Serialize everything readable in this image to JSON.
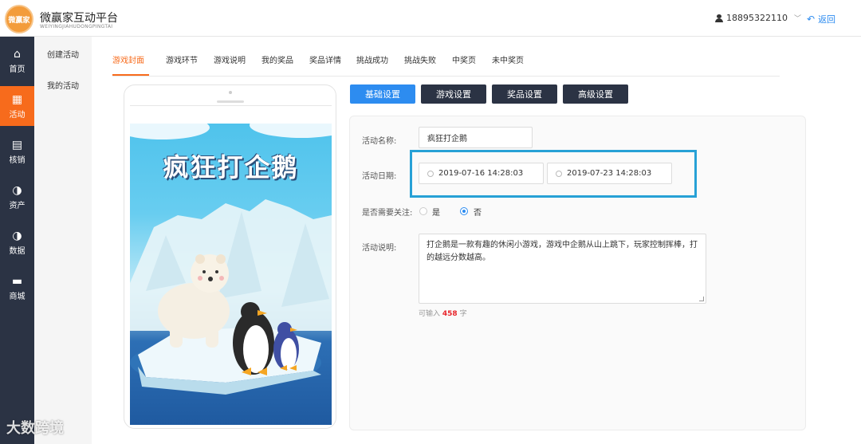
{
  "header": {
    "logo_text": "微赢家",
    "title": "微赢家互动平台",
    "subtitle": "WEIYINGJIAHUDONGPINGTAI",
    "user_phone": "18895322110",
    "back_label": "返回"
  },
  "sidenav": {
    "items": [
      {
        "label": "首页",
        "icon": "home-icon",
        "glyph": "⌂"
      },
      {
        "label": "活动",
        "icon": "gift-icon",
        "glyph": "▦"
      },
      {
        "label": "核销",
        "icon": "verify-icon",
        "glyph": "▤"
      },
      {
        "label": "资产",
        "icon": "asset-pie-icon",
        "glyph": "◑"
      },
      {
        "label": "数据",
        "icon": "data-pie-icon",
        "glyph": "◑"
      },
      {
        "label": "商城",
        "icon": "shop-icon",
        "glyph": "▬"
      }
    ],
    "active_index": 1
  },
  "submenu": {
    "items": [
      "创建活动",
      "我的活动"
    ]
  },
  "tabs": {
    "items": [
      "游戏封面",
      "游戏环节",
      "游戏说明",
      "我的奖品",
      "奖品详情",
      "挑战成功",
      "挑战失败",
      "中奖页",
      "未中奖页"
    ],
    "active_index": 0
  },
  "preview": {
    "game_title": "疯狂打企鹅"
  },
  "settings_tabs": {
    "items": [
      "基础设置",
      "游戏设置",
      "奖品设置",
      "高级设置"
    ],
    "active_index": 0
  },
  "form": {
    "name_label": "活动名称:",
    "name_value": "疯狂打企鹅",
    "date_label": "活动日期:",
    "date_start": "2019-07-16 14:28:03",
    "date_end": "2019-07-23 14:28:03",
    "follow_label": "是否需要关注:",
    "follow_yes": "是",
    "follow_no": "否",
    "follow_selected": "否",
    "desc_label": "活动说明:",
    "desc_value": "打企鹅是一款有趣的休闲小游戏，游戏中企鹅从山上跳下，玩家控制挥棒，打的越远分数越高。",
    "hint_prefix": "可输入",
    "hint_count": "458",
    "hint_suffix": "字"
  },
  "watermark": "大数跨境",
  "colors": {
    "accent": "#f76b1c",
    "primary": "#2d8cf0",
    "nav_bg": "#2b3344",
    "highlight": "#27a1d6"
  }
}
